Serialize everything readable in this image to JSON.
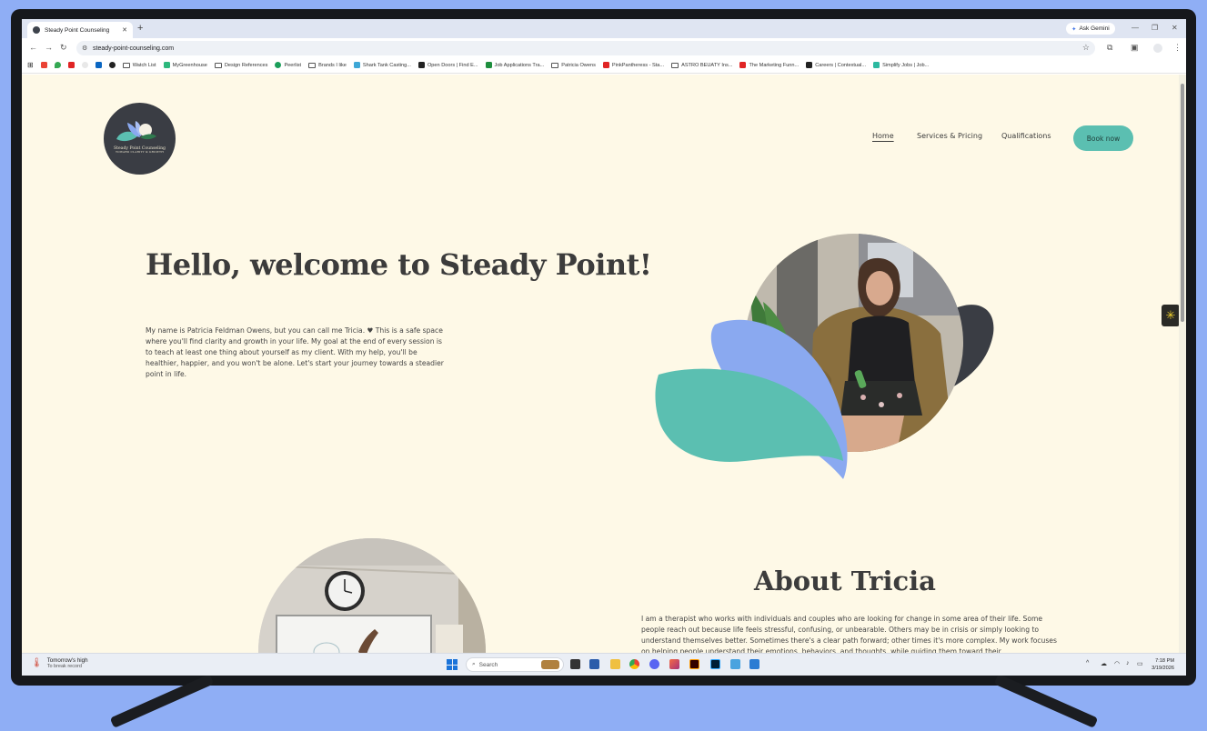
{
  "browser": {
    "tab_title": "Steady Point Counseling",
    "new_tab": "+",
    "ask_gemini": "Ask Gemini",
    "url": "steady-point-counseling.com",
    "bookmarks": [
      "Watch List",
      "MyGreenhouse",
      "Design References",
      "Peerlist",
      "Brands I like",
      "Shark Tank Casting...",
      "Open Doors | Find E...",
      "Job Applications Tra...",
      "Patricia Owens",
      "PinkPantheress - Sta...",
      "ASTRO BEUATY Ins...",
      "The Marketing Funn...",
      "Careers | Contextual...",
      "Simplify Jobs | Job..."
    ]
  },
  "site": {
    "logo": {
      "name": "Steady Point Counseling",
      "tagline": "TOWARD CLARITY & GROWTH"
    },
    "nav": {
      "home": "Home",
      "services": "Services & Pricing",
      "qualifications": "Qualifications",
      "book": "Book now"
    },
    "hero": {
      "title": "Hello, welcome to Steady Point!",
      "text": "My name is Patricia Feldman Owens, but you can call me Tricia. ♥ This is a safe space where you'll find clarity and growth in your life. My goal at the end of every session is to teach at least one thing about yourself as my client. With my help, you'll be healthier, happier, and you won't be alone. Let's start your journey towards a steadier point in life."
    },
    "about": {
      "title": "About Tricia",
      "text": "I am a therapist who works with individuals and couples who are looking for change in some area of their life. Some people reach out because life feels stressful, confusing, or unbearable. Others may be in crisis or simply looking to understand themselves better. Sometimes there's a clear path forward; other times it's more complex. My work focuses on helping people understand their emotions, behaviors, and thoughts, while guiding them toward their"
    },
    "colors": {
      "background": "#fef9e7",
      "teal": "#5bbfb1",
      "periwinkle": "#8aa9f0",
      "charcoal": "#3a3d44"
    }
  },
  "taskbar": {
    "weather_title": "Tomorrow's high",
    "weather_sub": "To break record",
    "search_placeholder": "Search",
    "time": "7:18 PM",
    "date": "3/19/2026"
  }
}
